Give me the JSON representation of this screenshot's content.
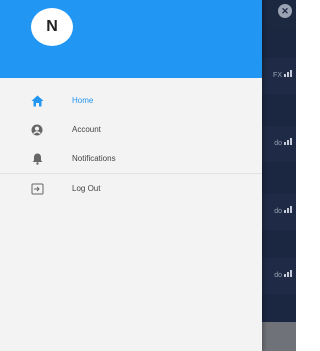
{
  "drawer": {
    "avatar_initial": "N",
    "header_color": "#2196f3",
    "items": [
      {
        "label": "Home",
        "icon": "home-icon",
        "active": true
      },
      {
        "label": "Account",
        "icon": "account-icon",
        "active": false
      },
      {
        "label": "Notifications",
        "icon": "bell-icon",
        "active": false
      },
      {
        "label": "Log Out",
        "icon": "logout-icon",
        "active": false
      }
    ]
  },
  "background": {
    "card_labels": [
      "FX",
      "do",
      "do",
      "do"
    ],
    "close_icon": "close-icon"
  },
  "colors": {
    "accent": "#2196f3",
    "background_app": "#1b2640"
  }
}
